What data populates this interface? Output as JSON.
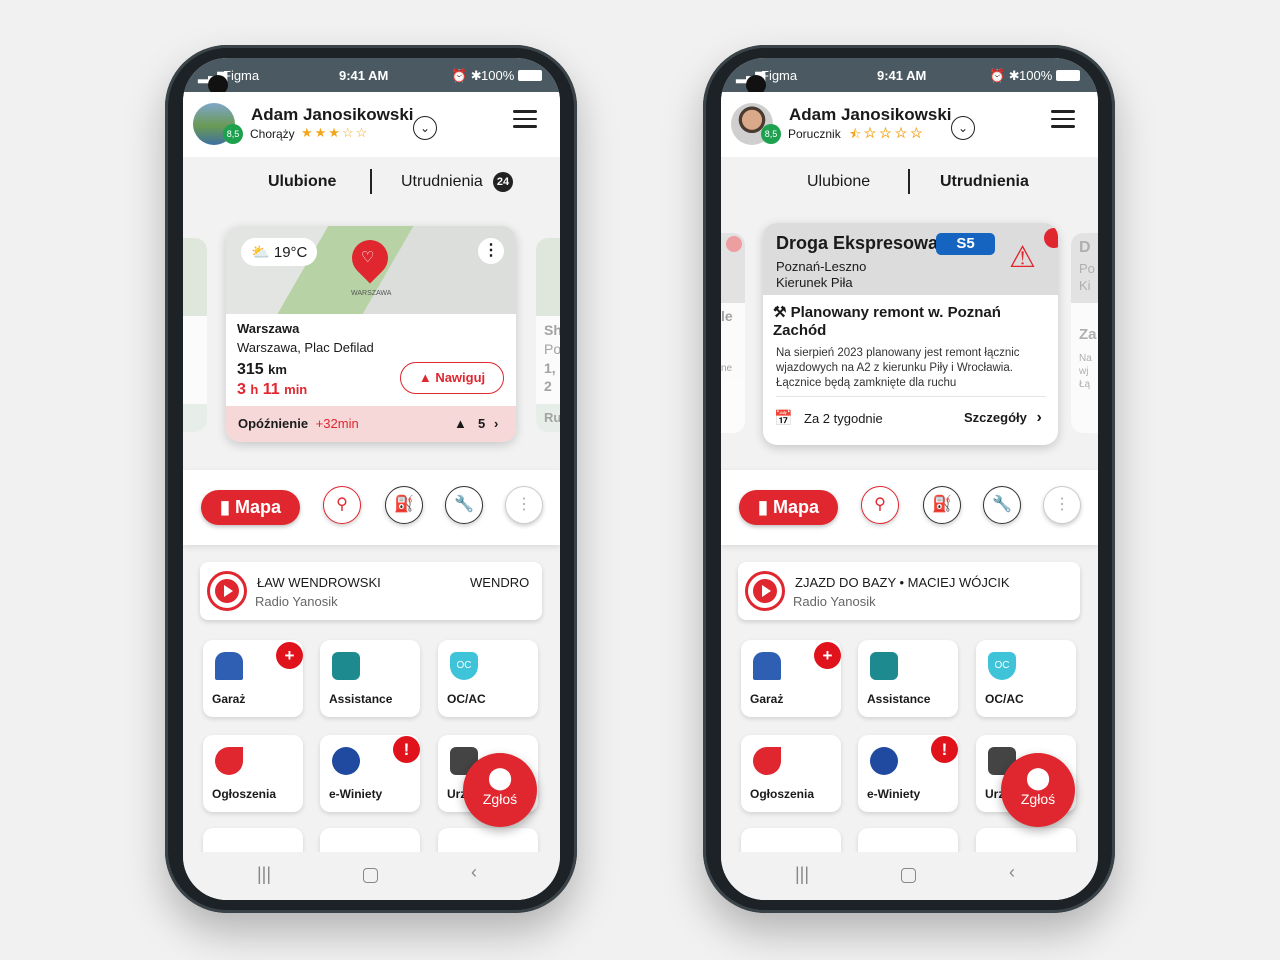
{
  "colors": {
    "accent": "#e0262e",
    "status_bar": "#4b5a62",
    "score": "#1ea14f",
    "road_badge": "#1565c0"
  },
  "phones": [
    {
      "status": {
        "carrier": "Figma",
        "time": "9:41 AM",
        "battery": "100%"
      },
      "header": {
        "name": "Adam Janosikowski",
        "rank": "Chorąży",
        "rating_stars": 3,
        "stars_text": "★★★☆☆",
        "score": "8,5"
      },
      "tabs": [
        {
          "label": "Ulubione",
          "active": true
        },
        {
          "label": "Utrudnienia",
          "badge": "24"
        }
      ],
      "card": {
        "weather": "19°C",
        "map_label": "WARSZAWA",
        "title": "Warszawa",
        "address": "Warszawa, Plac Defilad",
        "distance": "315",
        "distance_unit": "km",
        "hours": "3",
        "h": "h",
        "minutes": "11",
        "min": "min",
        "navigate": "Nawiguj",
        "delay_label": "Opóźnienie",
        "delay": "+32min",
        "warnings": "5"
      },
      "peek_right": [
        "Sh",
        "Po",
        "1,",
        "2",
        "Ru"
      ],
      "toolbar": {
        "map": "Mapa"
      },
      "radio": {
        "title": "ŁAW WENDROWSKI",
        "title2": "WENDRO",
        "station": "Radio Yanosik"
      },
      "tiles": [
        "Garaż",
        "Assistance",
        "OC/AC",
        "Ogłoszenia",
        "e-Winiety",
        "Urz"
      ],
      "fab": "Zgłoś"
    },
    {
      "status": {
        "carrier": "Figma",
        "time": "9:41 AM",
        "battery": "100%"
      },
      "header": {
        "name": "Adam Janosikowski",
        "rank": "Porucznik",
        "rating_stars": 0.5,
        "stars_text": "⯪☆☆☆☆",
        "score": "8,5"
      },
      "tabs": [
        {
          "label": "Ulubione"
        },
        {
          "label": "Utrudnienia",
          "active": true
        }
      ],
      "card": {
        "road": "Droga Ekspresowa",
        "road_badge": "S5",
        "route": "Poznań-Leszno",
        "direction": "Kierunek Piła",
        "title": "Planowany remont w. Poznań Zachód",
        "desc": "Na sierpień 2023 planowany jest remont łącznic wjazdowych na A2 z kierunku Piły i Wrocławia. Łącznice będą zamknięte dla ruchu",
        "when": "Za 2 tygodnie",
        "details": "Szczegóły"
      },
      "peek_left": [
        "le",
        "ne"
      ],
      "peek_right": [
        "D",
        "Po",
        "Ki",
        "Za",
        "Na",
        "wj",
        "Łą"
      ],
      "toolbar": {
        "map": "Mapa"
      },
      "radio": {
        "title": "ZJAZD DO BAZY • MACIEJ WÓJCIK",
        "station": "Radio Yanosik"
      },
      "tiles": [
        "Garaż",
        "Assistance",
        "OC/AC",
        "Ogłoszenia",
        "e-Winiety",
        "Urz"
      ],
      "fab": "Zgłoś"
    }
  ]
}
